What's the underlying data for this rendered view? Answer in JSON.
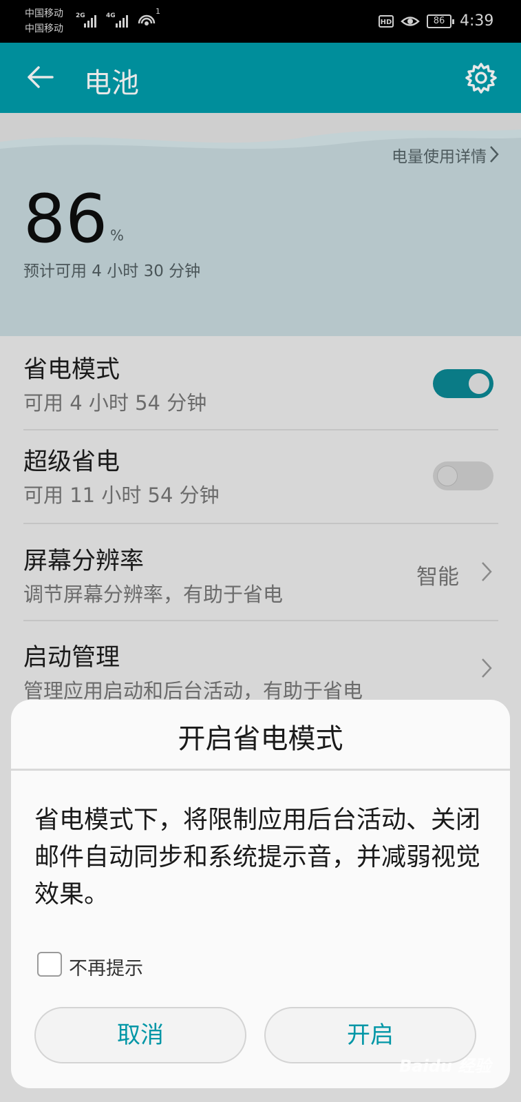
{
  "status_bar": {
    "carrier1": "中国移动",
    "carrier2": "中国移动",
    "net_tag1": "2G",
    "net_tag2": "4G",
    "wifi_badge": "1",
    "hd_label": "HD",
    "battery_level": "86",
    "time": "4:39"
  },
  "app_bar": {
    "title": "电池",
    "back_icon": "arrow-left-icon",
    "settings_icon": "gear-icon",
    "color": "#008e9b"
  },
  "battery": {
    "details_link": "电量使用详情",
    "percent": "86",
    "percent_unit": "%",
    "estimate": "预计可用 4 小时 30 分钟"
  },
  "settings": [
    {
      "title": "省电模式",
      "subtitle": "可用 4 小时 54 分钟",
      "toggle_on": true
    },
    {
      "title": "超级省电",
      "subtitle": "可用 11 小时 54 分钟",
      "toggle_on": false
    },
    {
      "title": "屏幕分辨率",
      "subtitle": "调节屏幕分辨率，有助于省电",
      "value": "智能"
    },
    {
      "title": "启动管理",
      "subtitle": "管理应用启动和后台活动，有助于省电"
    }
  ],
  "dialog": {
    "title": "开启省电模式",
    "message": "省电模式下，将限制应用后台活动、关闭邮件自动同步和系统提示音，并减弱视觉效果。",
    "checkbox_label": "不再提示",
    "checkbox_checked": false,
    "cancel_label": "取消",
    "confirm_label": "开启",
    "accent_color": "#0096a6"
  },
  "watermark": "Baidu 经验"
}
